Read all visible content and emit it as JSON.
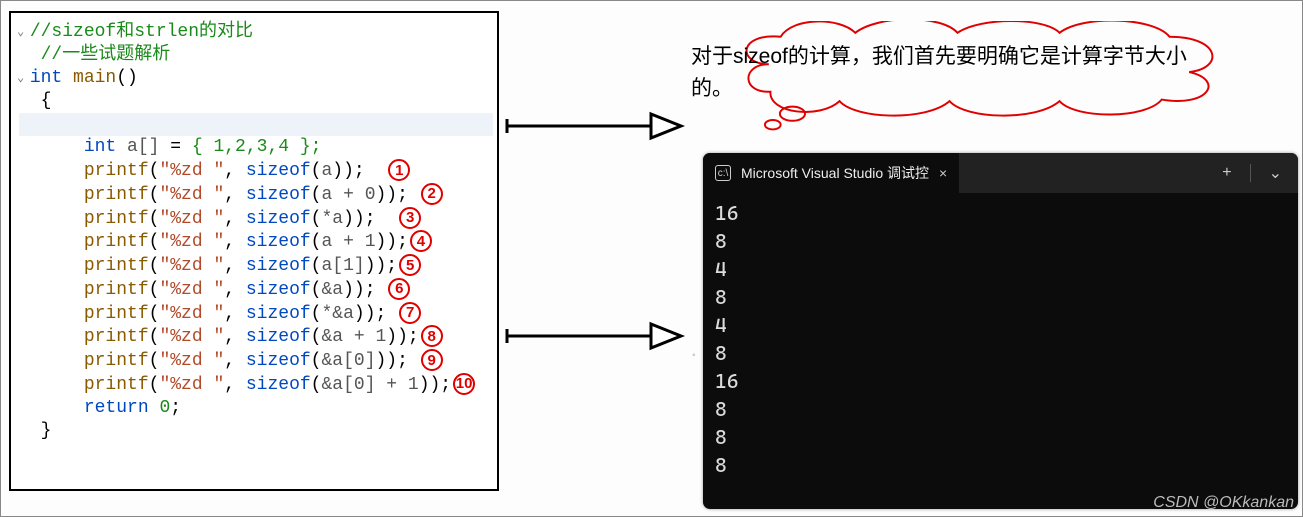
{
  "comments": {
    "line1": "//sizeof和strlen的对比",
    "line2": "//一些试题解析"
  },
  "signature": {
    "kw_int": "int",
    "fn_main": "main",
    "parens": "()"
  },
  "decl": {
    "kw_int": "int",
    "var": "a[]",
    "init": "{ 1,2,3,4 };"
  },
  "printf_label": "printf",
  "fmt": "\"%zd \"",
  "sizeof_kw": "sizeof",
  "args": {
    "1": "a",
    "2": "a + 0",
    "3": "*a",
    "4": "a + 1",
    "5": "a[1]",
    "6": "&a",
    "7": "*&a",
    "8": "&a + 1",
    "9": "&a[0]",
    "10": "&a[0] + 1"
  },
  "labels": {
    "1": "1",
    "2": "2",
    "3": "3",
    "4": "4",
    "5": "5",
    "6": "6",
    "7": "7",
    "8": "8",
    "9": "9",
    "10": "10"
  },
  "return_line": {
    "kw": "return",
    "val": "0"
  },
  "cloud_text_1": "对于sizeof的计算，我们首先要明确它是计算字节大小",
  "cloud_text_2": "的。",
  "terminal": {
    "title": "Microsoft Visual Studio 调试控",
    "close": "×",
    "plus": "+",
    "chev": "⌄",
    "output": [
      "16",
      "8",
      "4",
      "8",
      "4",
      "8",
      "16",
      "8",
      "8",
      "8"
    ]
  },
  "watermark": "CSDN @OKkankan"
}
